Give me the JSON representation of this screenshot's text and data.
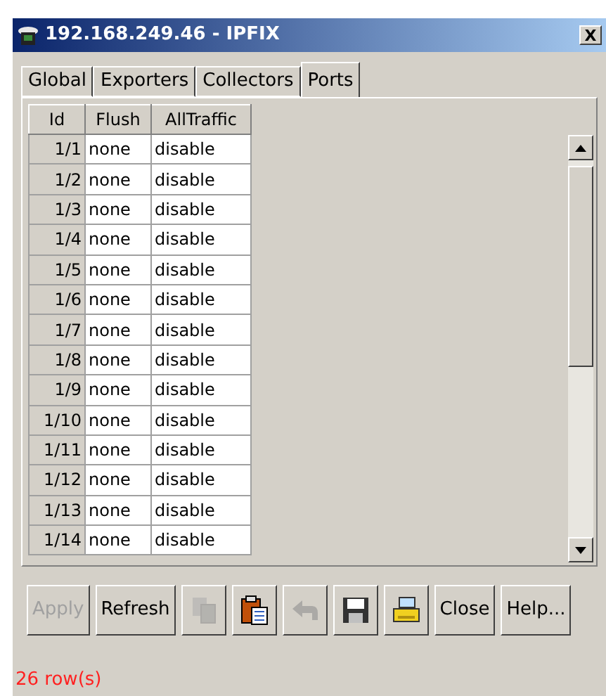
{
  "window": {
    "title": "192.168.249.46 - IPFIX",
    "close": "X"
  },
  "tabs": [
    {
      "label": "Global",
      "selected": false
    },
    {
      "label": "Exporters",
      "selected": false
    },
    {
      "label": "Collectors",
      "selected": false
    },
    {
      "label": "Ports",
      "selected": true
    }
  ],
  "table": {
    "columns": [
      "Id",
      "Flush",
      "AllTraffic"
    ],
    "rows": [
      [
        "1/1",
        "none",
        "disable"
      ],
      [
        "1/2",
        "none",
        "disable"
      ],
      [
        "1/3",
        "none",
        "disable"
      ],
      [
        "1/4",
        "none",
        "disable"
      ],
      [
        "1/5",
        "none",
        "disable"
      ],
      [
        "1/6",
        "none",
        "disable"
      ],
      [
        "1/7",
        "none",
        "disable"
      ],
      [
        "1/8",
        "none",
        "disable"
      ],
      [
        "1/9",
        "none",
        "disable"
      ],
      [
        "1/10",
        "none",
        "disable"
      ],
      [
        "1/11",
        "none",
        "disable"
      ],
      [
        "1/12",
        "none",
        "disable"
      ],
      [
        "1/13",
        "none",
        "disable"
      ],
      [
        "1/14",
        "none",
        "disable"
      ]
    ]
  },
  "buttons": [
    {
      "kind": "text",
      "label": "Apply",
      "disabled": true
    },
    {
      "kind": "text",
      "label": "Refresh",
      "disabled": false
    },
    {
      "kind": "copy",
      "disabled": true
    },
    {
      "kind": "paste",
      "disabled": false
    },
    {
      "kind": "undo",
      "disabled": true
    },
    {
      "kind": "save",
      "disabled": false
    },
    {
      "kind": "print",
      "disabled": false
    },
    {
      "kind": "text",
      "label": "Close",
      "disabled": false
    },
    {
      "kind": "text",
      "label": "Help...",
      "disabled": false
    }
  ],
  "status_bar": "26 row(s)"
}
